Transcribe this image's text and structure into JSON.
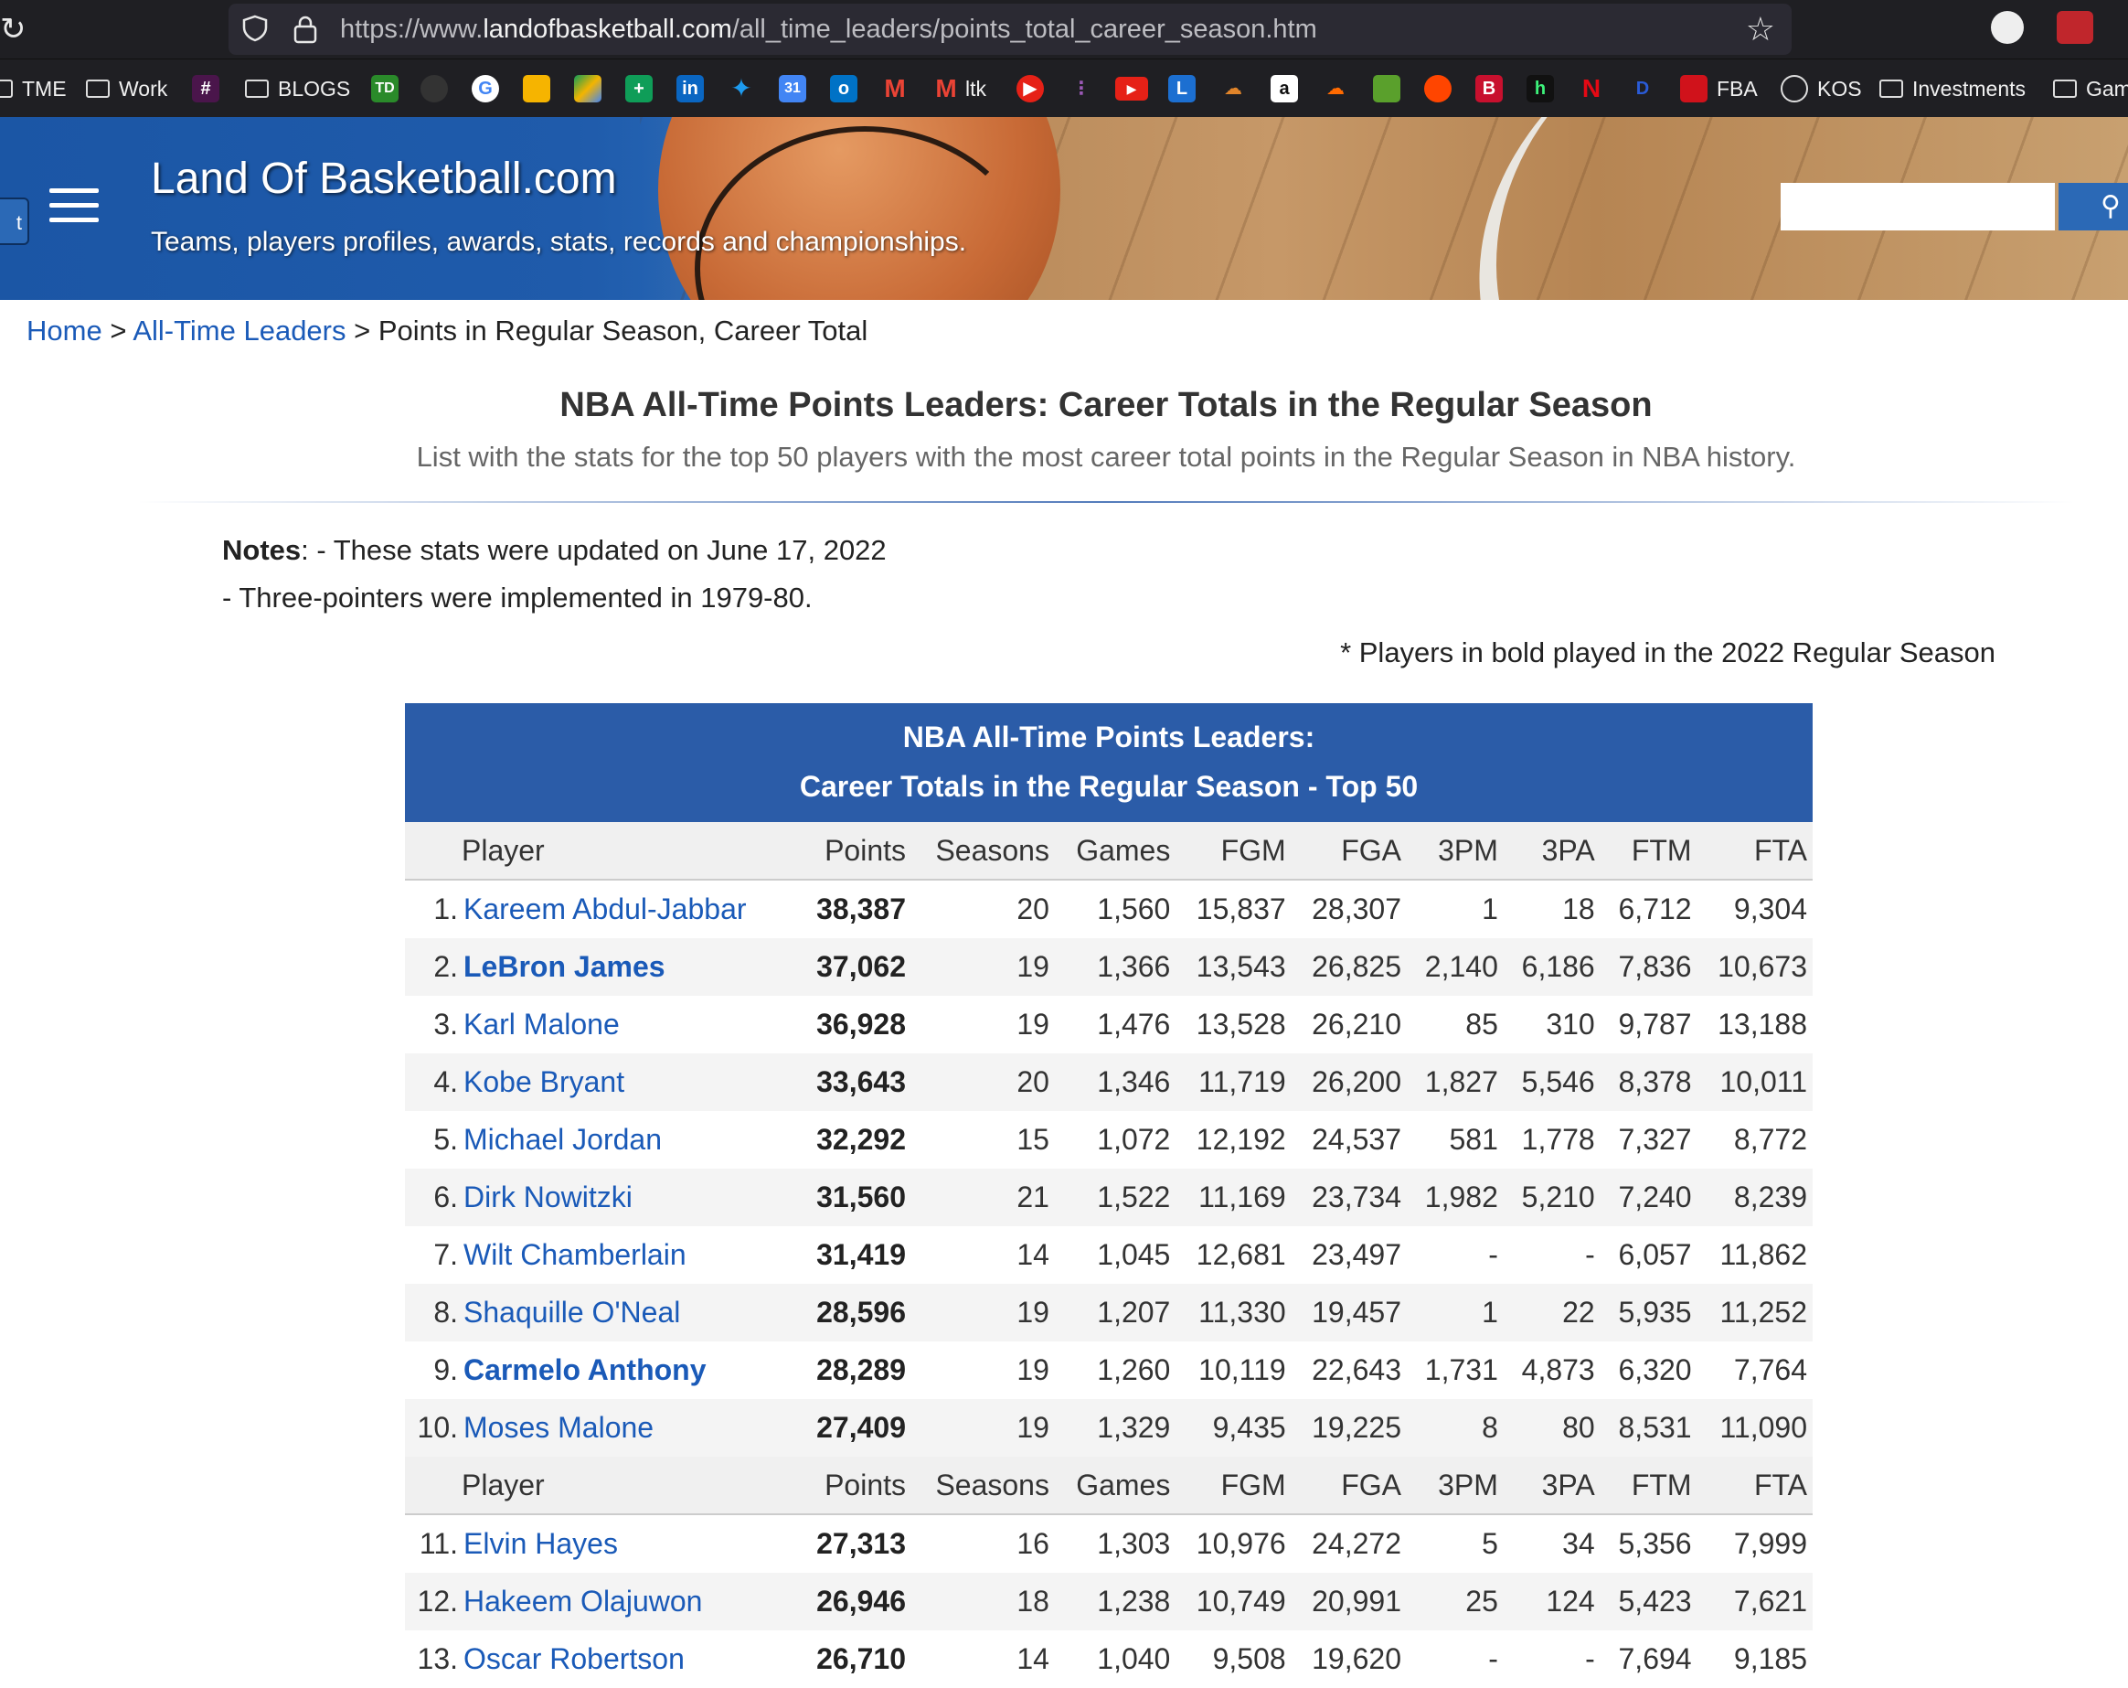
{
  "browser": {
    "url_prefix": "https://www.",
    "url_domain": "landofbasketball.com",
    "url_path": "/all_time_leaders/points_total_career_season.htm",
    "bookmarks": [
      {
        "label": "TME",
        "type": "folder"
      },
      {
        "label": "Work",
        "type": "folder"
      },
      {
        "label": "BLOGS",
        "type": "folder"
      },
      {
        "label": "ltk",
        "type": "site"
      },
      {
        "label": "FBA",
        "type": "site"
      },
      {
        "label": "KOS",
        "type": "site"
      },
      {
        "label": "Investments",
        "type": "folder"
      },
      {
        "label": "Gam",
        "type": "folder"
      }
    ]
  },
  "site": {
    "title": "Land Of Basketball.com",
    "tagline": "Teams, players profiles, awards, stats, records and championships.",
    "tab_stub": "t"
  },
  "breadcrumb": {
    "home": "Home",
    "sep": ">",
    "leaders": "All-Time Leaders",
    "current": "Points in Regular Season, Career Total"
  },
  "page": {
    "title": "NBA All-Time Points Leaders: Career Totals in the Regular Season",
    "subtitle": "List with the stats for the top 50 players with the most career total points in the Regular Season in NBA history.",
    "notes_label": "Notes",
    "note1": ": - These stats were updated on June 17, 2022",
    "note2": "- Three-pointers were implemented in 1979-80.",
    "bold_note": "* Players in bold played in the 2022 Regular Season"
  },
  "table": {
    "caption_line1": "NBA All-Time Points Leaders:",
    "caption_line2": "Career Totals in the Regular Season - Top 50",
    "columns": [
      "Player",
      "Points",
      "Seasons",
      "Games",
      "FGM",
      "FGA",
      "3PM",
      "3PA",
      "FTM",
      "FTA"
    ],
    "rows": [
      {
        "rank": "1.",
        "player": "Kareem Abdul-Jabbar",
        "active": false,
        "points": "38,387",
        "seasons": "20",
        "games": "1,560",
        "fgm": "15,837",
        "fga": "28,307",
        "tpm": "1",
        "tpa": "18",
        "ftm": "6,712",
        "fta": "9,304"
      },
      {
        "rank": "2.",
        "player": "LeBron James",
        "active": true,
        "points": "37,062",
        "seasons": "19",
        "games": "1,366",
        "fgm": "13,543",
        "fga": "26,825",
        "tpm": "2,140",
        "tpa": "6,186",
        "ftm": "7,836",
        "fta": "10,673"
      },
      {
        "rank": "3.",
        "player": "Karl Malone",
        "active": false,
        "points": "36,928",
        "seasons": "19",
        "games": "1,476",
        "fgm": "13,528",
        "fga": "26,210",
        "tpm": "85",
        "tpa": "310",
        "ftm": "9,787",
        "fta": "13,188"
      },
      {
        "rank": "4.",
        "player": "Kobe Bryant",
        "active": false,
        "points": "33,643",
        "seasons": "20",
        "games": "1,346",
        "fgm": "11,719",
        "fga": "26,200",
        "tpm": "1,827",
        "tpa": "5,546",
        "ftm": "8,378",
        "fta": "10,011"
      },
      {
        "rank": "5.",
        "player": "Michael Jordan",
        "active": false,
        "points": "32,292",
        "seasons": "15",
        "games": "1,072",
        "fgm": "12,192",
        "fga": "24,537",
        "tpm": "581",
        "tpa": "1,778",
        "ftm": "7,327",
        "fta": "8,772"
      },
      {
        "rank": "6.",
        "player": "Dirk Nowitzki",
        "active": false,
        "points": "31,560",
        "seasons": "21",
        "games": "1,522",
        "fgm": "11,169",
        "fga": "23,734",
        "tpm": "1,982",
        "tpa": "5,210",
        "ftm": "7,240",
        "fta": "8,239"
      },
      {
        "rank": "7.",
        "player": "Wilt Chamberlain",
        "active": false,
        "points": "31,419",
        "seasons": "14",
        "games": "1,045",
        "fgm": "12,681",
        "fga": "23,497",
        "tpm": "-",
        "tpa": "-",
        "ftm": "6,057",
        "fta": "11,862"
      },
      {
        "rank": "8.",
        "player": "Shaquille O'Neal",
        "active": false,
        "points": "28,596",
        "seasons": "19",
        "games": "1,207",
        "fgm": "11,330",
        "fga": "19,457",
        "tpm": "1",
        "tpa": "22",
        "ftm": "5,935",
        "fta": "11,252"
      },
      {
        "rank": "9.",
        "player": "Carmelo Anthony",
        "active": true,
        "points": "28,289",
        "seasons": "19",
        "games": "1,260",
        "fgm": "10,119",
        "fga": "22,643",
        "tpm": "1,731",
        "tpa": "4,873",
        "ftm": "6,320",
        "fta": "7,764"
      },
      {
        "rank": "10.",
        "player": "Moses Malone",
        "active": false,
        "points": "27,409",
        "seasons": "19",
        "games": "1,329",
        "fgm": "9,435",
        "fga": "19,225",
        "tpm": "8",
        "tpa": "80",
        "ftm": "8,531",
        "fta": "11,090"
      },
      {
        "header": true
      },
      {
        "rank": "11.",
        "player": "Elvin Hayes",
        "active": false,
        "points": "27,313",
        "seasons": "16",
        "games": "1,303",
        "fgm": "10,976",
        "fga": "24,272",
        "tpm": "5",
        "tpa": "34",
        "ftm": "5,356",
        "fta": "7,999"
      },
      {
        "rank": "12.",
        "player": "Hakeem Olajuwon",
        "active": false,
        "points": "26,946",
        "seasons": "18",
        "games": "1,238",
        "fgm": "10,749",
        "fga": "20,991",
        "tpm": "25",
        "tpa": "124",
        "ftm": "5,423",
        "fta": "7,621"
      },
      {
        "rank": "13.",
        "player": "Oscar Robertson",
        "active": false,
        "points": "26,710",
        "seasons": "14",
        "games": "1,040",
        "fgm": "9,508",
        "fga": "19,620",
        "tpm": "-",
        "tpa": "-",
        "ftm": "7,694",
        "fta": "9,185"
      }
    ]
  },
  "colors": {
    "header_blue": "#1f5aa8",
    "link_blue": "#1a5ab8",
    "caption_blue": "#2b5ca8"
  }
}
